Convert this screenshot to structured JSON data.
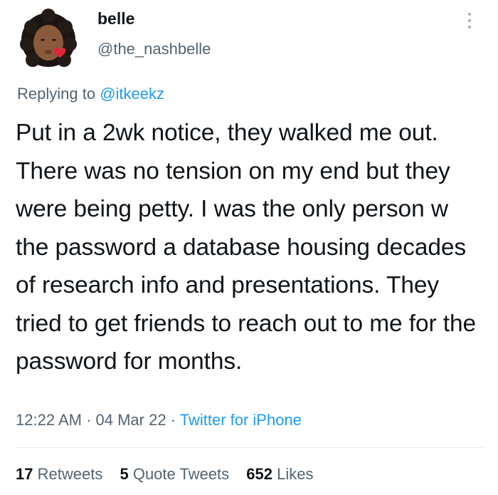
{
  "user": {
    "display_name": "belle",
    "handle": "@the_nashbelle",
    "avatar_icon": "memoji-avatar-icon"
  },
  "reply": {
    "prefix": "Replying to ",
    "to": "@itkeekz"
  },
  "tweet": {
    "text": "Put in a 2wk notice, they walked me out. There was no tension on my end but they were being petty. I was the only person w the password a database housing decades of research info and presentations. They tried to get friends to reach out to me for the password for months."
  },
  "meta": {
    "time": "12:22 AM",
    "sep1": " · ",
    "date": "04 Mar 22",
    "sep2": " · ",
    "source": "Twitter for iPhone"
  },
  "stats": {
    "retweets_count": "17",
    "retweets_label": "Retweets",
    "quotes_count": "5",
    "quotes_label": "Quote Tweets",
    "likes_count": "652",
    "likes_label": "Likes"
  },
  "colors": {
    "link": "#1d9bf0",
    "secondary_text": "#536471",
    "primary_text": "#0f1419",
    "divider": "#e6ecf0"
  }
}
